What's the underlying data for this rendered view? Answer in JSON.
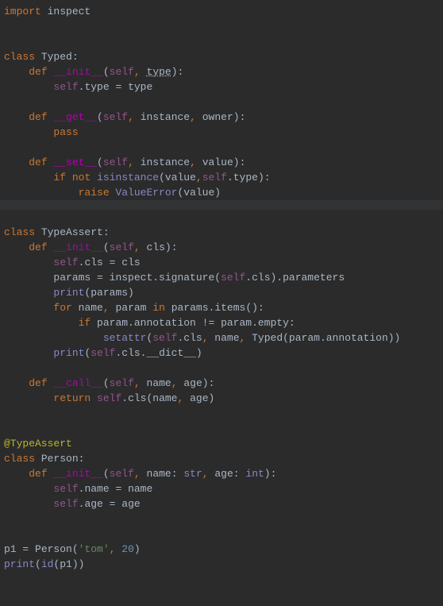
{
  "code": {
    "l1_import": "import",
    "l1_inspect": "inspect",
    "l3_class": "class",
    "l3_name": "Typed",
    "l4_def": "def",
    "l4_name": "__init__",
    "l4_self": "self",
    "l4_type": "type",
    "l5_self": "self",
    "l5_attr": ".type",
    "l5_eq": " = ",
    "l5_val": "type",
    "l7_def": "def",
    "l7_name": "__get__",
    "l7_self": "self",
    "l7_p1": "instance",
    "l7_p2": "owner",
    "l8_pass": "pass",
    "l10_def": "def",
    "l10_name": "__set__",
    "l10_self": "self",
    "l10_p1": "instance",
    "l10_p2": "value",
    "l11_if": "if",
    "l11_not": "not",
    "l11_isinstance": "isinstance",
    "l11_val": "value",
    "l11_self": "self",
    "l11_attr": ".type)",
    "l12_raise": "raise",
    "l12_err": "ValueError",
    "l12_val": "value",
    "l14_class": "class",
    "l14_name": "TypeAssert",
    "l15_def": "def",
    "l15_name": "__init__",
    "l15_self": "self",
    "l15_p1": "cls",
    "l16_self": "self",
    "l16_attr": ".cls",
    "l16_eq": " = ",
    "l16_val": "cls",
    "l17_params": "params",
    "l17_eq": " = ",
    "l17_inspect": "inspect.signature(",
    "l17_self": "self",
    "l17_rest": ".cls).parameters",
    "l18_print": "print",
    "l18_arg": "(params)",
    "l19_for": "for",
    "l19_name": "name",
    "l19_param": " param",
    "l19_in": "in",
    "l19_rest": " params.items():",
    "l20_if": "if",
    "l20_cond": " param.annotation",
    "l20_ne": " != ",
    "l20_rest": "param.empty:",
    "l21_setattr": "setattr",
    "l21_self": "self",
    "l21_mid": ".cls",
    "l21_name": " name",
    "l21_typed": " Typed(param.annotation))",
    "l22_print": "print",
    "l22_open": "(",
    "l22_self": "self",
    "l22_rest": ".cls.__dict__)",
    "l24_def": "def",
    "l24_name": "__call__",
    "l24_self": "self",
    "l24_p1": "name",
    "l24_p2": "age",
    "l25_return": "return",
    "l25_self": "self",
    "l25_rest": ".cls(name",
    "l25_age": " age)",
    "l27_dec": "@TypeAssert",
    "l28_class": "class",
    "l28_name": "Person",
    "l29_def": "def",
    "l29_name": "__init__",
    "l29_self": "self",
    "l29_p1": "name",
    "l29_t1": "str",
    "l29_p2": "age",
    "l29_t2": "int",
    "l30_self": "self",
    "l30_attr": ".name",
    "l30_eq": " = ",
    "l30_val": "name",
    "l31_self": "self",
    "l31_attr": ".age",
    "l31_eq": " = ",
    "l31_val": "age",
    "l33_p1": "p1",
    "l33_eq": " = ",
    "l33_person": "Person(",
    "l33_str": "'tom'",
    "l33_num": "20",
    "l34_print": "print",
    "l34_id": "id",
    "l34_arg": "(p1))"
  }
}
